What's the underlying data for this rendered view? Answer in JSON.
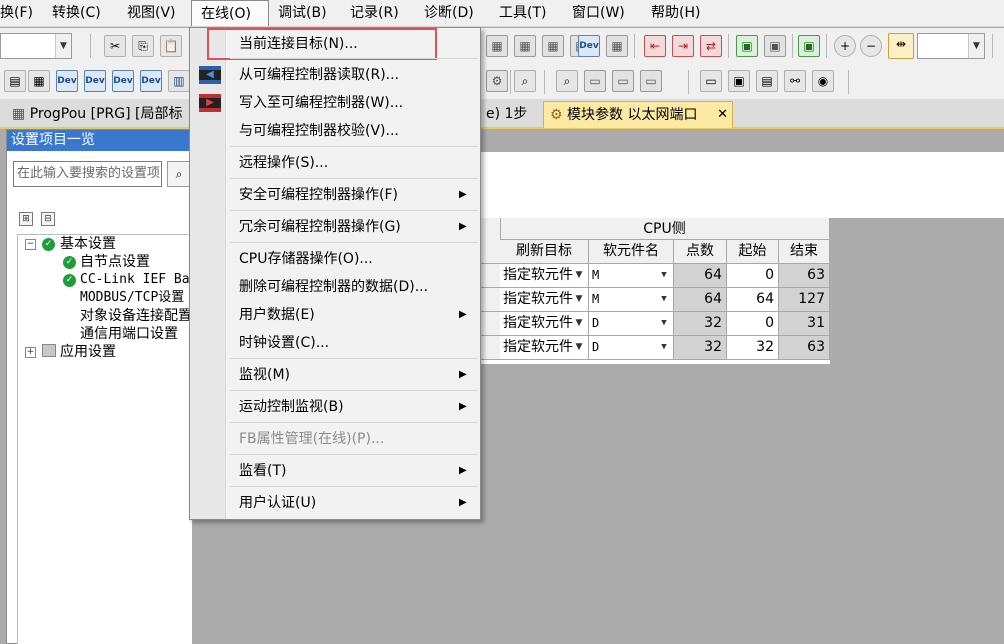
{
  "menubar": [
    "换(F)",
    "转换(C)",
    "视图(V)",
    "在线(O)",
    "调试(B)",
    "记录(R)",
    "诊断(D)",
    "工具(T)",
    "窗口(W)",
    "帮助(H)"
  ],
  "tabs": [
    {
      "label": "ProgPou [PRG] [局部标"
    },
    {
      "label": "e) 1步"
    },
    {
      "label": "模块参数 以太网端口"
    }
  ],
  "panel": {
    "title": "设置项目一览",
    "search_placeholder": "在此输入要搜索的设置项",
    "tree": [
      {
        "label": "基本设置"
      },
      {
        "label": "自节点设置"
      },
      {
        "label": "CC-Link IEF Basic设置"
      },
      {
        "label": "MODBUS/TCP设置"
      },
      {
        "label": "对象设备连接配置设置"
      },
      {
        "label": "通信用端口设置"
      },
      {
        "label": "应用设置"
      }
    ]
  },
  "table": {
    "group_header": "CPU侧",
    "columns": [
      "刷新目标",
      "软元件名",
      "点数",
      "起始",
      "结束"
    ],
    "rows": [
      {
        "target": "指定软元件",
        "device": "M",
        "points": "64",
        "start": "0",
        "end": "63"
      },
      {
        "target": "指定软元件",
        "device": "M",
        "points": "64",
        "start": "64",
        "end": "127"
      },
      {
        "target": "指定软元件",
        "device": "D",
        "points": "32",
        "start": "0",
        "end": "31"
      },
      {
        "target": "指定软元件",
        "device": "D",
        "points": "32",
        "start": "32",
        "end": "63"
      }
    ]
  },
  "online_menu": [
    {
      "label": "当前连接目标(N)...",
      "submenu": false,
      "disabled": false
    },
    {
      "label": "从可编程控制器读取(R)...",
      "submenu": false,
      "disabled": false
    },
    {
      "label": "写入至可编程控制器(W)...",
      "submenu": false,
      "disabled": false
    },
    {
      "label": "与可编程控制器校验(V)...",
      "submenu": false,
      "disabled": false
    },
    {
      "label": "远程操作(S)...",
      "submenu": false,
      "disabled": false
    },
    {
      "label": "安全可编程控制器操作(F)",
      "submenu": true,
      "disabled": false
    },
    {
      "label": "冗余可编程控制器操作(G)",
      "submenu": true,
      "disabled": false
    },
    {
      "label": "CPU存储器操作(O)...",
      "submenu": false,
      "disabled": false
    },
    {
      "label": "删除可编程控制器的数据(D)...",
      "submenu": false,
      "disabled": false
    },
    {
      "label": "用户数据(E)",
      "submenu": true,
      "disabled": false
    },
    {
      "label": "时钟设置(C)...",
      "submenu": false,
      "disabled": false
    },
    {
      "label": "监视(M)",
      "submenu": true,
      "disabled": false
    },
    {
      "label": "运动控制监视(B)",
      "submenu": true,
      "disabled": false
    },
    {
      "label": "FB属性管理(在线)(P)...",
      "submenu": false,
      "disabled": true
    },
    {
      "label": "监看(T)",
      "submenu": true,
      "disabled": false
    },
    {
      "label": "用户认证(U)",
      "submenu": true,
      "disabled": false
    }
  ],
  "toolbar_icons": {
    "dev_label": "Dev",
    "close_glyph": "✕",
    "submenu_glyph": "▶",
    "dropdown_glyph": "▼"
  },
  "colors": {
    "highlight_border": "#e05050",
    "panel_title_bg": "#3a78cf",
    "active_tab": "#fbe9a4",
    "status_ok": "#1f9d3a"
  }
}
